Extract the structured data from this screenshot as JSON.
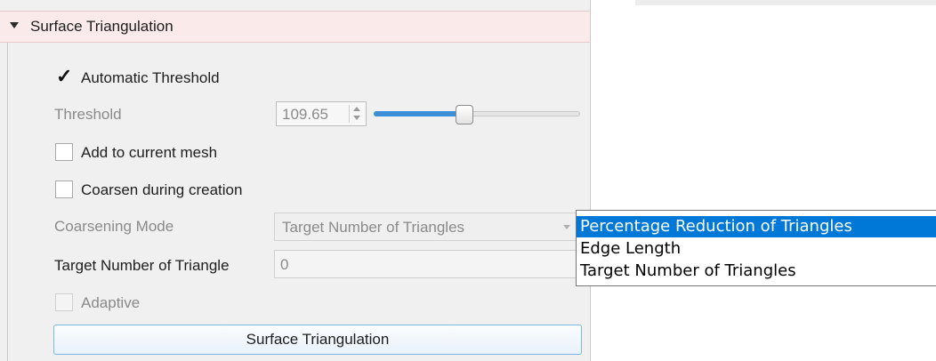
{
  "panel": {
    "title": "Surface Triangulation"
  },
  "form": {
    "automatic_threshold": {
      "label": "Automatic Threshold",
      "checked": true
    },
    "threshold": {
      "label": "Threshold",
      "value": "109.65",
      "slider_fraction": 0.44
    },
    "add_to_current_mesh": {
      "label": "Add to current mesh",
      "checked": false
    },
    "coarsen_during_creation": {
      "label": "Coarsen during creation",
      "checked": false
    },
    "coarsening_mode": {
      "label": "Coarsening Mode",
      "value": "Target Number of Triangles"
    },
    "target_number": {
      "label": "Target Number of Triangle",
      "value": "0"
    },
    "adaptive": {
      "label": "Adaptive",
      "checked": false
    },
    "run_button": {
      "label": "Surface Triangulation"
    }
  },
  "dropdown": {
    "options": [
      "Percentage Reduction of Triangles",
      "Edge Length",
      "Target Number of Triangles"
    ],
    "highlighted_index": 0
  },
  "colors": {
    "header_bg": "#fbeaea",
    "accent": "#0078d7",
    "slider_fill": "#3a8fd6"
  }
}
